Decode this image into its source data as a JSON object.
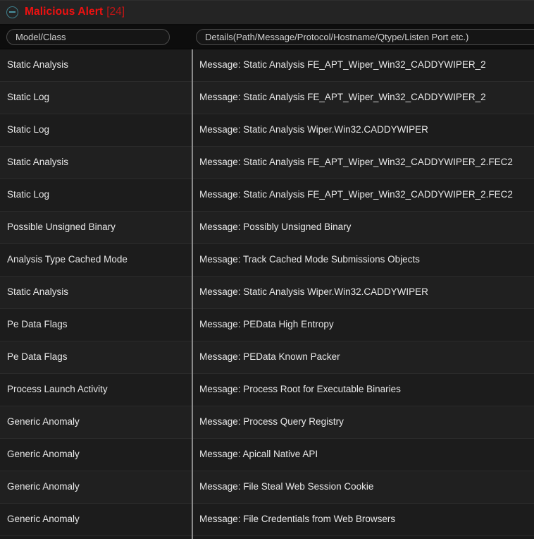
{
  "header": {
    "collapse_icon": "minus-circle-icon",
    "title": "Malicious Alert",
    "count": "[24]",
    "title_color": "#ee1111",
    "count_color": "#c01515",
    "icon_color": "#4a93a1"
  },
  "filters": {
    "model": {
      "value": "",
      "placeholder": "Model/Class"
    },
    "details": {
      "value": "",
      "placeholder": "Details(Path/Message/Protocol/Hostname/Qtype/Listen Port etc.)"
    }
  },
  "table": {
    "columns": [
      "Model/Class",
      "Details"
    ],
    "rows": [
      {
        "model": "Static Analysis",
        "details": "Message: Static Analysis FE_APT_Wiper_Win32_CADDYWIPER_2"
      },
      {
        "model": "Static Log",
        "details": "Message: Static Analysis FE_APT_Wiper_Win32_CADDYWIPER_2"
      },
      {
        "model": "Static Log",
        "details": "Message: Static Analysis Wiper.Win32.CADDYWIPER"
      },
      {
        "model": "Static Analysis",
        "details": "Message: Static Analysis FE_APT_Wiper_Win32_CADDYWIPER_2.FEC2"
      },
      {
        "model": "Static Log",
        "details": "Message: Static Analysis FE_APT_Wiper_Win32_CADDYWIPER_2.FEC2"
      },
      {
        "model": "Possible Unsigned Binary",
        "details": "Message: Possibly Unsigned Binary"
      },
      {
        "model": "Analysis Type Cached Mode",
        "details": "Message: Track Cached Mode Submissions Objects"
      },
      {
        "model": "Static Analysis",
        "details": "Message: Static Analysis Wiper.Win32.CADDYWIPER"
      },
      {
        "model": "Pe Data Flags",
        "details": "Message: PEData High Entropy"
      },
      {
        "model": "Pe Data Flags",
        "details": "Message: PEData Known Packer"
      },
      {
        "model": "Process Launch Activity",
        "details": "Message: Process Root for Executable Binaries"
      },
      {
        "model": "Generic Anomaly",
        "details": "Message: Process Query Registry"
      },
      {
        "model": "Generic Anomaly",
        "details": "Message: Apicall Native API"
      },
      {
        "model": "Generic Anomaly",
        "details": "Message: File Steal Web Session Cookie"
      },
      {
        "model": "Generic Anomaly",
        "details": "Message: File Credentials from Web Browsers"
      }
    ]
  }
}
